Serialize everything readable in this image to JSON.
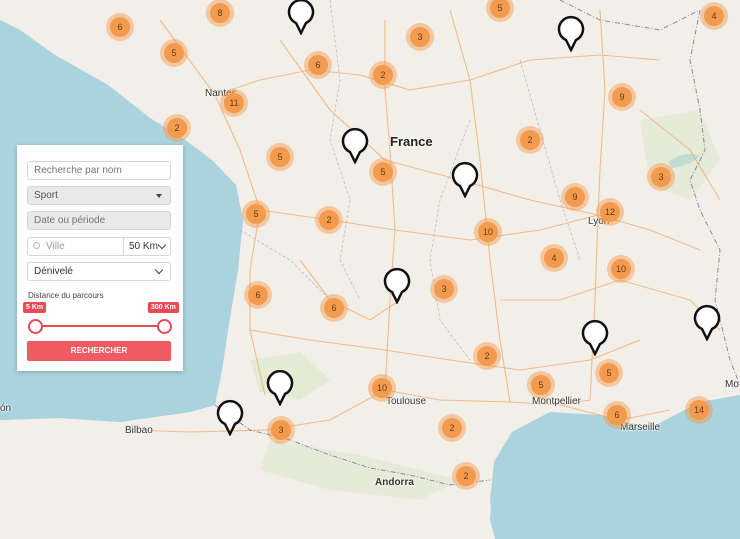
{
  "map": {
    "country_label": "France",
    "cities": [
      {
        "id": "nantes",
        "name": "Nantes"
      },
      {
        "id": "lyon",
        "name": "Lyon"
      },
      {
        "id": "toulouse",
        "name": "Toulouse"
      },
      {
        "id": "montpellier",
        "name": "Montpellier"
      },
      {
        "id": "marseille",
        "name": "Marseille"
      },
      {
        "id": "bilbao",
        "name": "Bilbao"
      },
      {
        "id": "andorra",
        "name": "Andorra"
      },
      {
        "id": "left-edge",
        "name": "ón"
      },
      {
        "id": "right-edge",
        "name": "Mo"
      }
    ],
    "clusters": [
      6,
      8,
      5,
      5,
      3,
      6,
      2,
      9,
      4,
      11,
      2,
      2,
      5,
      5,
      9,
      12,
      3,
      5,
      2,
      10,
      4,
      10,
      6,
      3,
      6,
      2,
      5,
      10,
      5,
      14,
      3,
      2,
      2,
      6
    ],
    "pin_count": 9
  },
  "filters": {
    "name_placeholder": "Recherche par nom",
    "sport_label": "Sport",
    "date_placeholder": "Date ou période",
    "city_placeholder": "Ville",
    "distance_radius": "50 Km",
    "elevation_label": "Dénivelé",
    "range_label": "Distance du parcours",
    "range_min": "5 Km",
    "range_max": "300 Km",
    "search_button": "RECHERCHER"
  },
  "colors": {
    "water": "#aad3df",
    "land": "#f2efe9",
    "cluster": "#f29a4e",
    "button": "#f05a62"
  }
}
